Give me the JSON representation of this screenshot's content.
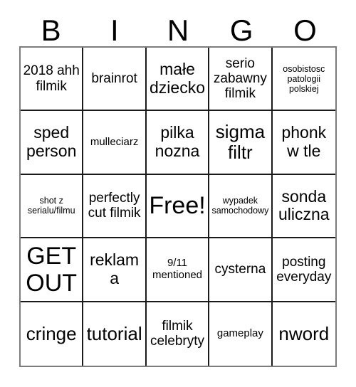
{
  "card": {
    "title_letters": [
      "B",
      "I",
      "N",
      "G",
      "O"
    ],
    "free_space_label": "Free!",
    "colors": {
      "background": "#ffffff",
      "text": "#000000",
      "cell_border": "#1a1a1a",
      "outer_border": "#7d7d7d"
    },
    "grid": {
      "columns": 5,
      "rows": 5
    },
    "cells": [
      {
        "text": "2018 ahh filmik",
        "size": "m"
      },
      {
        "text": "brainrot",
        "size": "m"
      },
      {
        "text": "małe dziecko",
        "size": "l"
      },
      {
        "text": "serio zabawny filmik",
        "size": "m"
      },
      {
        "text": "osobistosc patologii polskiej",
        "size": "xs"
      },
      {
        "text": "sped person",
        "size": "l"
      },
      {
        "text": "mulleciarz",
        "size": "s"
      },
      {
        "text": "pilka nozna",
        "size": "l"
      },
      {
        "text": "sigma filtr",
        "size": "xl"
      },
      {
        "text": "phonk w tle",
        "size": "l"
      },
      {
        "text": "shot z serialu/filmu",
        "size": "xs"
      },
      {
        "text": "perfectly cut filmik",
        "size": "m"
      },
      {
        "text": "Free!",
        "size": "xxl"
      },
      {
        "text": "wypadek samochodowy",
        "size": "xs"
      },
      {
        "text": "sonda uliczna",
        "size": "l"
      },
      {
        "text": "GET OUT",
        "size": "xxl"
      },
      {
        "text": "reklama",
        "size": "l"
      },
      {
        "text": "9/11 mentioned",
        "size": "s"
      },
      {
        "text": "cysterna",
        "size": "m"
      },
      {
        "text": "posting everyday",
        "size": "m"
      },
      {
        "text": "cringe",
        "size": "xl"
      },
      {
        "text": "tutorial",
        "size": "xl"
      },
      {
        "text": "filmik celebryty",
        "size": "m"
      },
      {
        "text": "gameplay",
        "size": "s"
      },
      {
        "text": "nword",
        "size": "xl"
      }
    ]
  }
}
